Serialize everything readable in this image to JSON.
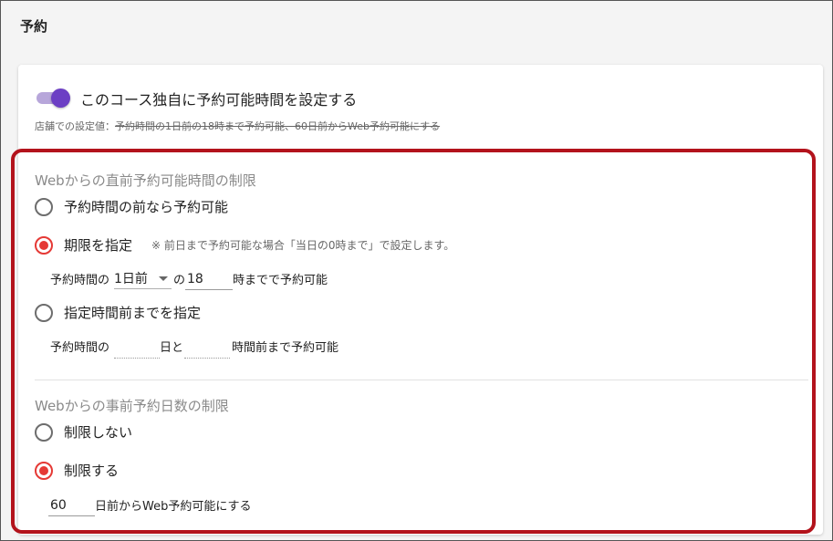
{
  "section_title": "予約",
  "custom_time": {
    "enabled": true,
    "label": "このコース独自に予約可能時間を設定する",
    "default_prefix": "店舗での設定値：",
    "default_value": "予約時間の1日前の18時まで予約可能、60日前からWeb予約可能にする"
  },
  "deadline": {
    "heading": "Webからの直前予約可能時間の制限",
    "options": [
      {
        "label": "予約時間の前なら予約可能",
        "checked": false
      },
      {
        "label": "期限を指定",
        "checked": true
      },
      {
        "label": "指定時間前までを指定",
        "checked": false
      }
    ],
    "deadline_hint": "※ 前日まで予約可能な場合「当日の0時まで」で設定します。",
    "deadline_prefix": "予約時間の",
    "deadline_day_select": "1日前",
    "deadline_hour_prefix": "の",
    "deadline_hour_value": "18",
    "deadline_suffix": "時までで予約可能",
    "before_prefix": "予約時間の",
    "before_days_value": "",
    "before_days_unit": "日と",
    "before_hours_value": "",
    "before_suffix": "時間前まで予約可能"
  },
  "advance": {
    "heading": "Webからの事前予約日数の制限",
    "options": [
      {
        "label": "制限しない",
        "checked": false
      },
      {
        "label": "制限する",
        "checked": true
      }
    ],
    "days_value": "60",
    "days_suffix": "日前からWeb予約可能にする"
  },
  "colors": {
    "toggle_on": "#6c3fc4",
    "radio_checked": "#e53935",
    "highlight_border": "#b3131c"
  }
}
